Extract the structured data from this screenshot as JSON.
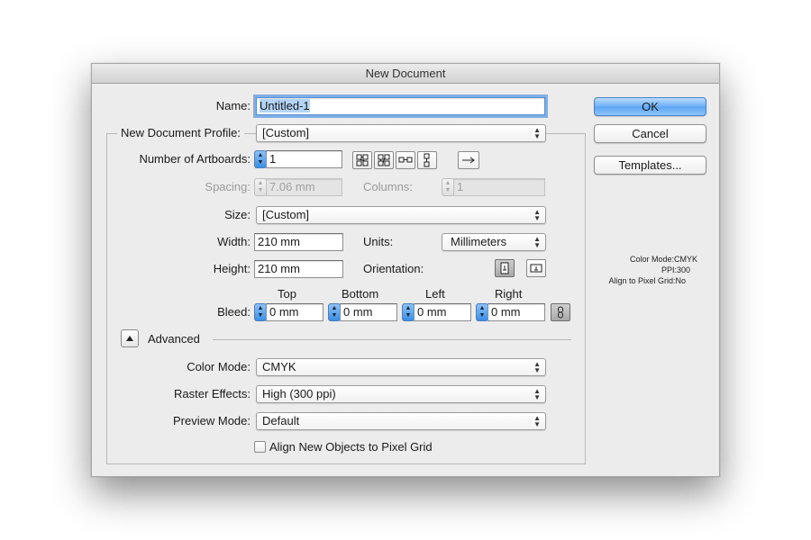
{
  "window": {
    "title": "New Document"
  },
  "buttons": {
    "ok": "OK",
    "cancel": "Cancel",
    "templates": "Templates..."
  },
  "fields": {
    "name_label": "Name:",
    "name_value": "Untitled-1",
    "profile_label": "New Document Profile:",
    "profile_value": "[Custom]",
    "artboards_label": "Number of Artboards:",
    "artboards_value": "1",
    "spacing_label": "Spacing:",
    "spacing_value": "7.06 mm",
    "columns_label": "Columns:",
    "columns_value": "1",
    "size_label": "Size:",
    "size_value": "[Custom]",
    "width_label": "Width:",
    "width_value": "210 mm",
    "units_label": "Units:",
    "units_value": "Millimeters",
    "height_label": "Height:",
    "height_value": "210 mm",
    "orientation_label": "Orientation:"
  },
  "bleed": {
    "label": "Bleed:",
    "top_label": "Top",
    "top_value": "0 mm",
    "bottom_label": "Bottom",
    "bottom_value": "0 mm",
    "left_label": "Left",
    "left_value": "0 mm",
    "right_label": "Right",
    "right_value": "0 mm"
  },
  "advanced": {
    "label": "Advanced",
    "color_mode_label": "Color Mode:",
    "color_mode_value": "CMYK",
    "raster_label": "Raster Effects:",
    "raster_value": "High (300 ppi)",
    "preview_label": "Preview Mode:",
    "preview_value": "Default",
    "pixel_grid_label": "Align New Objects to Pixel Grid"
  },
  "summary": {
    "color_mode": "Color Mode:CMYK",
    "ppi": "PPI:300",
    "pixel_grid": "Align to Pixel Grid:No"
  },
  "icons": [
    "grid-by-row-icon",
    "grid-by-column-icon",
    "arrange-by-row-icon",
    "arrange-by-column-icon",
    "layout-direction-arrow-icon",
    "portrait-icon",
    "landscape-icon",
    "link-chain-icon",
    "disclosure-triangle-icon"
  ],
  "colors": {
    "default_button": "#6aaef7",
    "stepper": "#3b8fe6",
    "selection": "#b4d4f5"
  }
}
